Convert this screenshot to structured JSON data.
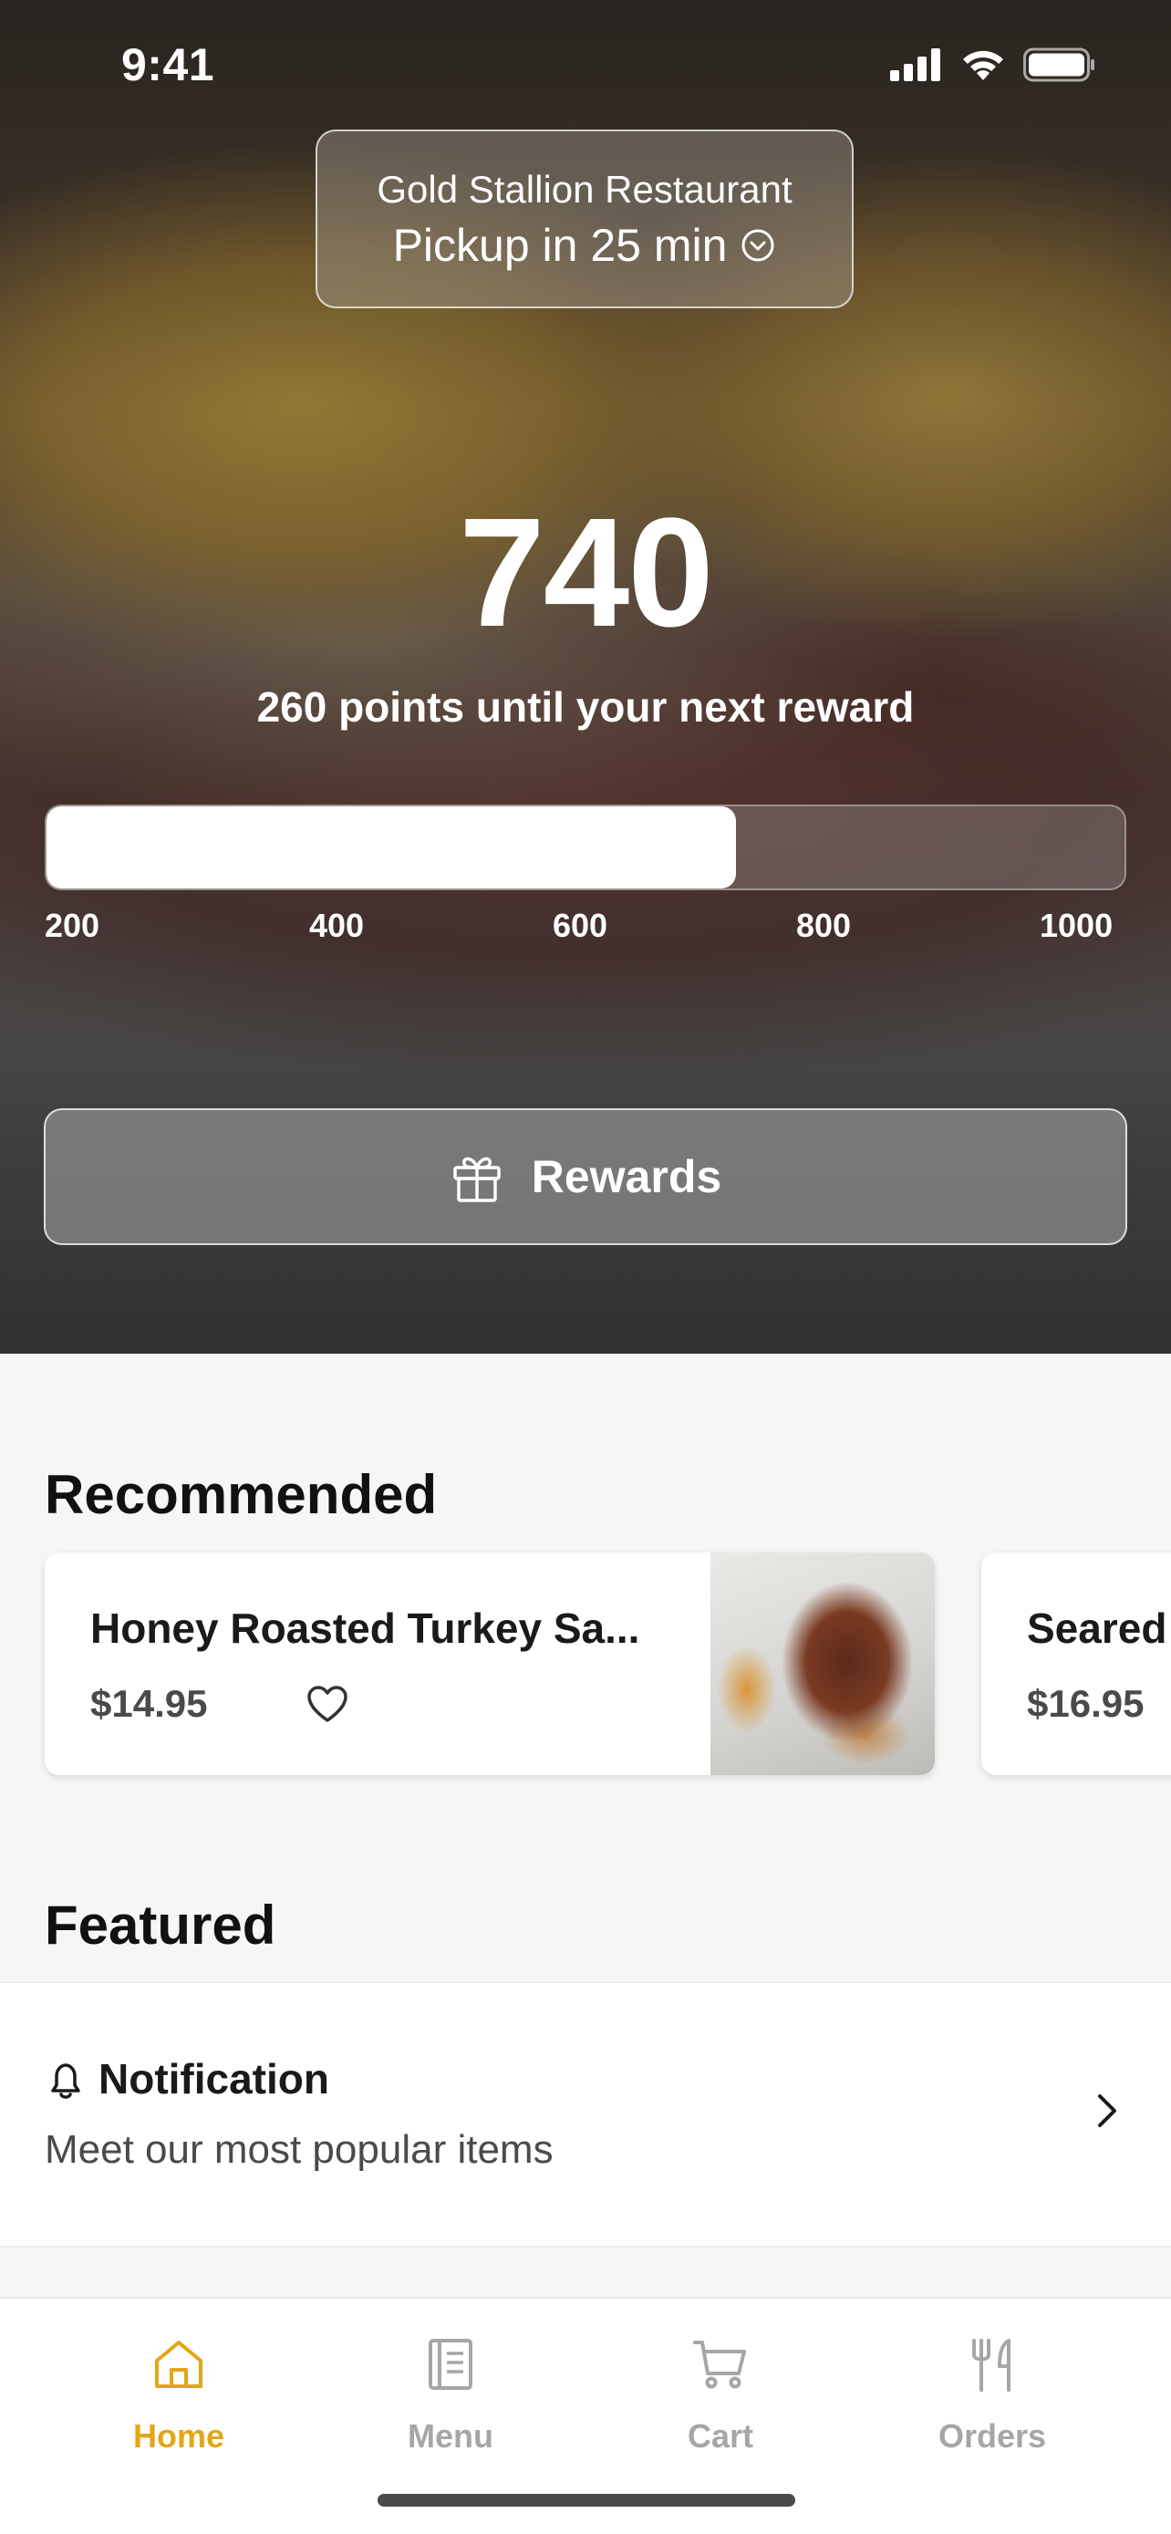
{
  "status_bar": {
    "time": "9:41"
  },
  "store": {
    "name": "Gold Stallion Restaurant",
    "pickup": "Pickup in 25 min"
  },
  "rewards": {
    "points": "740",
    "subtitle": "260 points until your next reward",
    "progress_fraction": 0.64,
    "tick_labels": [
      "200",
      "400",
      "600",
      "800",
      "1000"
    ],
    "button_label": "Rewards"
  },
  "recommended": {
    "title": "Recommended",
    "items": [
      {
        "name": "Honey Roasted Turkey Sa...",
        "price": "$14.95"
      },
      {
        "name": "Seared",
        "price": "$16.95"
      }
    ]
  },
  "featured": {
    "title": "Featured",
    "notification_title": "Notification",
    "notification_subtitle": "Meet our most popular items"
  },
  "tabs": [
    {
      "label": "Home",
      "active": true
    },
    {
      "label": "Menu",
      "active": false
    },
    {
      "label": "Cart",
      "active": false
    },
    {
      "label": "Orders",
      "active": false
    }
  ],
  "colors": {
    "accent": "#e3a617",
    "tab_inactive": "#a6a6a6",
    "background": "#f6f6f6"
  }
}
